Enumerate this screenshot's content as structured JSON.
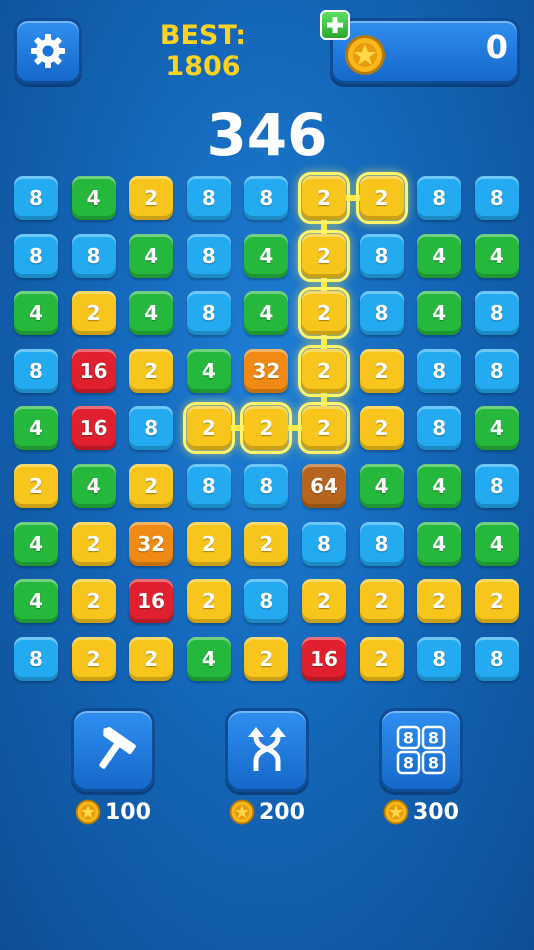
{
  "header": {
    "best_label": "BEST:",
    "best_value": "1806",
    "coins": "0",
    "score": "346"
  },
  "colors": {
    "2": "#f7c51c",
    "4": "#25b83d",
    "8": "#23aaf0",
    "16": "#e0202e",
    "32": "#f08a14",
    "64": "#b5651d",
    "selection": "#ffe83a"
  },
  "board": [
    [
      "8",
      "4",
      "2",
      "8",
      "8",
      "2",
      "2",
      "8",
      "8"
    ],
    [
      "8",
      "8",
      "4",
      "8",
      "4",
      "2",
      "8",
      "4",
      "4"
    ],
    [
      "4",
      "2",
      "4",
      "8",
      "4",
      "2",
      "8",
      "4",
      "8"
    ],
    [
      "8",
      "16",
      "2",
      "4",
      "32",
      "2",
      "2",
      "8",
      "8"
    ],
    [
      "4",
      "16",
      "8",
      "2",
      "2",
      "2",
      "2",
      "8",
      "4"
    ],
    [
      "2",
      "4",
      "2",
      "8",
      "8",
      "64",
      "4",
      "4",
      "8"
    ],
    [
      "4",
      "2",
      "32",
      "2",
      "2",
      "8",
      "8",
      "4",
      "4"
    ],
    [
      "4",
      "2",
      "16",
      "2",
      "8",
      "2",
      "2",
      "2",
      "2"
    ],
    [
      "8",
      "2",
      "2",
      "4",
      "2",
      "16",
      "2",
      "8",
      "8"
    ]
  ],
  "selected_path": [
    [
      0,
      6
    ],
    [
      0,
      5
    ],
    [
      1,
      5
    ],
    [
      2,
      5
    ],
    [
      3,
      5
    ],
    [
      4,
      5
    ],
    [
      4,
      4
    ],
    [
      4,
      3
    ]
  ],
  "powerups": [
    {
      "name": "hammer",
      "icon": "hammer-icon",
      "price": "100"
    },
    {
      "name": "swap",
      "icon": "swap-arrows-icon",
      "price": "200"
    },
    {
      "name": "shuffle",
      "icon": "grid-88-icon",
      "price": "300"
    }
  ]
}
